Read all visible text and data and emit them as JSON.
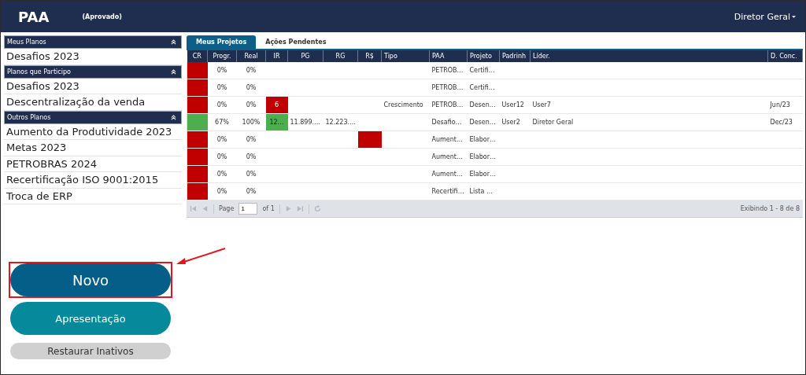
{
  "header": {
    "title": "PAA",
    "status": "(Aprovado)",
    "user": "Diretor Geral"
  },
  "sidebar": {
    "sections": [
      {
        "title": "Meus Planos",
        "items": [
          "Desafios 2023"
        ]
      },
      {
        "title": "Planos que Participo",
        "items": [
          "Desafios 2023",
          "Descentralização da venda"
        ]
      },
      {
        "title": "Outros Planos",
        "items": [
          "Aumento da Produtividade 2023",
          "Metas 2023",
          "PETROBRAS 2024",
          "Recertificação ISO 9001:2015",
          "Troca de ERP"
        ]
      }
    ]
  },
  "buttons": [
    {
      "label": "Novo",
      "kind": "primary",
      "highlighted": true
    },
    {
      "label": "Apresentação",
      "kind": "secondary",
      "highlighted": false
    },
    {
      "label": "Restaurar Inativos",
      "kind": "muted",
      "highlighted": false
    }
  ],
  "tabs": [
    {
      "label": "Meus Projetos",
      "selected": true
    },
    {
      "label": "Ações Pendentes",
      "selected": false
    }
  ],
  "table": {
    "columns": [
      "CR",
      "Progr.",
      "Real",
      "IR",
      "PG",
      "RG",
      "R$",
      "Tipo",
      "PAA",
      "Projeto",
      "Padrinh",
      "Líder.",
      "D. Conc."
    ],
    "rows": [
      {
        "cells": [
          {
            "color": "#c00000"
          },
          {
            "text": "0%"
          },
          {
            "text": "0%"
          },
          null,
          null,
          null,
          null,
          null,
          {
            "text": "PETROB…"
          },
          {
            "text": "Certifi…"
          },
          null,
          null,
          null
        ]
      },
      {
        "cells": [
          {
            "color": "#c00000"
          },
          {
            "text": "0%"
          },
          {
            "text": "0%"
          },
          null,
          null,
          null,
          null,
          null,
          {
            "text": "PETROB…"
          },
          {
            "text": "Certifi…"
          },
          null,
          null,
          null
        ]
      },
      {
        "cells": [
          {
            "color": "#c00000"
          },
          {
            "text": "0%"
          },
          {
            "text": "0%"
          },
          {
            "text": "6",
            "color": "#c00000"
          },
          null,
          null,
          null,
          {
            "text": "Crescimento"
          },
          {
            "text": "PETROB…"
          },
          {
            "text": "Desen…"
          },
          {
            "text": "User12"
          },
          {
            "text": "User7"
          },
          {
            "text": "Jun/23"
          }
        ]
      },
      {
        "cells": [
          {
            "color": "#4cae4c"
          },
          {
            "text": "67%"
          },
          {
            "text": "100%"
          },
          {
            "text": "12…",
            "color": "#4cae4c"
          },
          {
            "text": "11.899.…"
          },
          {
            "text": "12.223.…"
          },
          null,
          null,
          {
            "text": "Desafio…"
          },
          {
            "text": "Desen…"
          },
          {
            "text": "User2"
          },
          {
            "text": "Diretor Geral"
          },
          {
            "text": "Dec/23"
          }
        ]
      },
      {
        "cells": [
          {
            "color": "#c00000"
          },
          {
            "text": "0%"
          },
          {
            "text": "0%"
          },
          null,
          null,
          null,
          {
            "color": "#c00000"
          },
          null,
          {
            "text": "Aument…"
          },
          {
            "text": "Elabor…"
          },
          null,
          null,
          null
        ]
      },
      {
        "cells": [
          {
            "color": "#c00000"
          },
          {
            "text": "0%"
          },
          {
            "text": "0%"
          },
          null,
          null,
          null,
          null,
          null,
          {
            "text": "Aument…"
          },
          {
            "text": "Elabor…"
          },
          null,
          null,
          null
        ]
      },
      {
        "cells": [
          {
            "color": "#c00000"
          },
          {
            "text": "0%"
          },
          {
            "text": "0%"
          },
          null,
          null,
          null,
          null,
          null,
          {
            "text": "Aument…"
          },
          {
            "text": "Elabor…"
          },
          null,
          null,
          null
        ]
      },
      {
        "cells": [
          {
            "color": "#c00000"
          },
          {
            "text": "0%"
          },
          {
            "text": "0%"
          },
          null,
          null,
          null,
          null,
          null,
          {
            "text": "Recertifi…"
          },
          {
            "text": "Lista …"
          },
          null,
          null,
          null
        ]
      }
    ]
  },
  "pager": {
    "page_label": "Page",
    "page": "1",
    "of": "of 1",
    "summary": "Exibindo 1 - 8 de 8"
  }
}
